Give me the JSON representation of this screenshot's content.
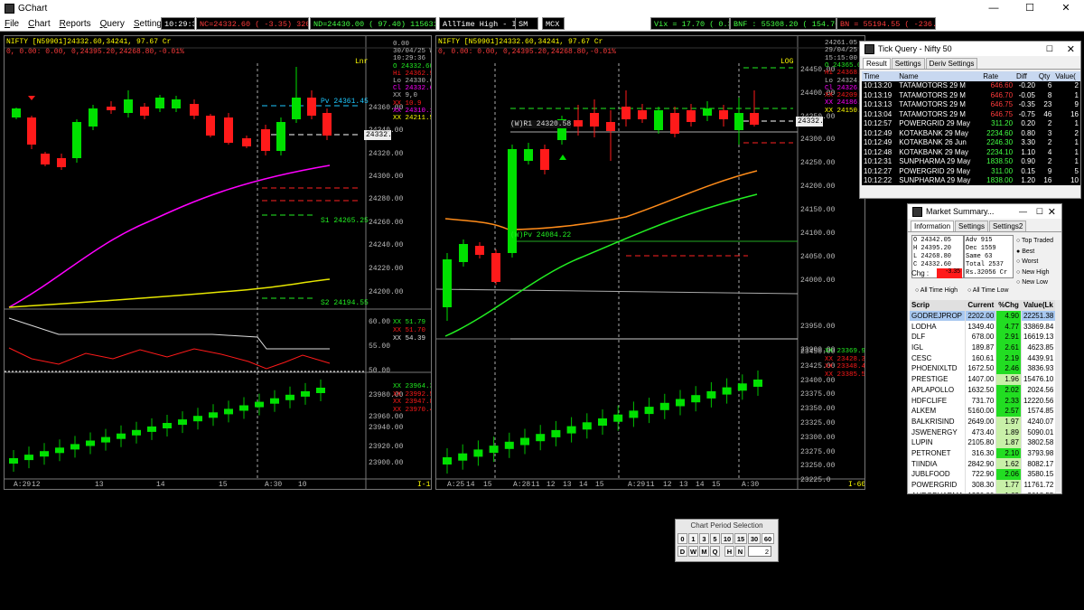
{
  "window": {
    "title": "GChart",
    "controls": [
      "—",
      "☐",
      "✕"
    ]
  },
  "menu": [
    "File",
    "Chart",
    "Reports",
    "Query",
    "Settings"
  ],
  "ticker": {
    "time": "10:29:37",
    "nc": "NC=24332.60 ( -3.35) 32056 Cr",
    "nd": "ND=24430.00 ( 97.40) 11563126 Cr",
    "ath": "AllTime High - INM",
    "sm": "SM",
    "mcx": "MCX",
    "vix": "Vix =   17.70 (  0.33)",
    "bnf": "BNF : 55308.20 ( 154.70)",
    "bn": "BN = 55194.55 ( -236.70)"
  },
  "colors": {
    "up": "#00e000",
    "down": "#ff1a1a",
    "ma_magenta": "#ff00ff",
    "ma_yellow": "#e6e600",
    "ma_orange": "#ff8c1a",
    "ma_green": "#22ee22"
  },
  "chart1": {
    "head": "NIFTY [N59901]24332.60,34241,  97.67  Cr",
    "sub": "0,   0.00:   0.00,  0,24395.20,24268.80,-0.01%",
    "info": [
      "0.00",
      "30/04/25 We",
      "10:29:36",
      "O 24332.60",
      "Hi 24362.9",
      "Lo 24330.65",
      "Cl 24332.60",
      "XX       9,0",
      "XX      10.9",
      "XX 24310.16",
      "XX 24211.50"
    ],
    "tag": "Lnr",
    "pv": "Pv 24361.45",
    "s1": "S1 24265.25",
    "s2": "S2 24194.55",
    "period": "I-15",
    "price_labels": [
      "24360.00",
      "24340.00",
      "24320.00",
      "24300.00",
      "24280.00",
      "24260.00",
      "24240.00",
      "24220.00",
      "24200.00"
    ],
    "last": "24332.6",
    "osc_labels": [
      "60.00",
      "55.00",
      "50.00"
    ],
    "osc_info": [
      "XX      51.79",
      "XX      51.70",
      "XX      54.39"
    ],
    "vol_labels": [
      "23980.00",
      "23960.00",
      "23940.00",
      "23920.00",
      "23900.00"
    ],
    "vol_info": [
      "XX 23964.30",
      "XX 23992.54",
      "XX 23947.89",
      "XX 23970.44"
    ],
    "x_labels": [
      "A:29",
      "12",
      "13",
      "14",
      "15",
      "A:30",
      "10"
    ]
  },
  "chart2": {
    "head": "NIFTY [N59901]24332.60,34241,  97.67  Cr",
    "sub": "0,   0.00:   0.00,  0,24395.20,24268.80,-0.01%",
    "info": [
      "24261.05",
      "29/04/25",
      "15:15:00",
      "O 24365.0",
      "Hi 24368.",
      "Lo 24324.4",
      "Cl 24326.3",
      "XX 24209.7",
      "XX 24186.6",
      "XX 24150.8"
    ],
    "tag": "LOG",
    "r1": "(W)R1 24320.58",
    "pv": "(W)Pv 24084.22",
    "period": "I-60",
    "price_labels": [
      "24450.00",
      "24400.00",
      "24350.00",
      "24300.00",
      "24250.00",
      "24200.00",
      "24150.00",
      "24100.00",
      "24050.00",
      "24000.00",
      "23950.00",
      "23900.00"
    ],
    "last": "24332.6",
    "vol_labels": [
      "23450.00",
      "23425.00",
      "23400.00",
      "23375.00",
      "23350.00",
      "23325.00",
      "23300.00",
      "23275.00",
      "23250.00",
      "23225.0"
    ],
    "vol_info": [
      "XX 23369.98",
      "XX 23428.35",
      "XX 23348.48",
      "XX 23385.56"
    ],
    "x_labels": [
      "A:25",
      "14",
      "15",
      "A:28",
      "11",
      "12",
      "13",
      "14",
      "15",
      "A:29",
      "11",
      "12",
      "13",
      "14",
      "15",
      "A:30"
    ]
  },
  "tick_query": {
    "title": "Tick Query - Nifty 50",
    "tabs": [
      "Result",
      "Settings",
      "Deriv Settings"
    ],
    "headers": [
      "Time",
      "Name",
      "Rate",
      "Diff",
      "Qty",
      "Value("
    ],
    "rows": [
      [
        "10:13:20",
        "TATAMOTORS 29 M",
        "646.60",
        "-0.20",
        "6",
        "2"
      ],
      [
        "10:13:19",
        "TATAMOTORS 29 M",
        "646.70",
        "-0.05",
        "8",
        "1"
      ],
      [
        "10:13:13",
        "TATAMOTORS 29 M",
        "646.75",
        "-0.35",
        "23",
        "9"
      ],
      [
        "10:13:04",
        "TATAMOTORS 29 M",
        "646.75",
        "-0.75",
        "46",
        "16"
      ],
      [
        "10:12:57",
        "POWERGRID 29 May",
        "311.20",
        "0.20",
        "2",
        "1"
      ],
      [
        "10:12:49",
        "KOTAKBANK 29 May",
        "2234.60",
        "0.80",
        "3",
        "2"
      ],
      [
        "10:12:49",
        "KOTAKBANK 26 Jun",
        "2246.30",
        "3.30",
        "2",
        "1"
      ],
      [
        "10:12:48",
        "KOTAKBANK 29 May",
        "2234.10",
        "1.10",
        "4",
        "1"
      ],
      [
        "10:12:31",
        "SUNPHARMA 29 May",
        "1838.50",
        "0.90",
        "2",
        "1"
      ],
      [
        "10:12:27",
        "POWERGRID 29 May",
        "311.00",
        "0.15",
        "9",
        "5"
      ],
      [
        "10:12:22",
        "SUNPHARMA 29 May",
        "1838.00",
        "1.20",
        "16",
        "10"
      ]
    ]
  },
  "market_summary": {
    "title": "Market Summary...",
    "tabs": [
      "Information",
      "Settings",
      "Settings2"
    ],
    "ohlc": [
      "O  24342.05",
      "H  24395.20",
      "L  24268.80",
      "C  24332.60"
    ],
    "stats": [
      "Adv    915",
      "Dec   1559",
      "Same    63",
      "Total 2537",
      "Rs.32056 Cr"
    ],
    "chg_label": "Chg :",
    "chg_value": "-3.35",
    "radios": [
      "Top Traded",
      "Best",
      "Worst",
      "New High",
      "New Low"
    ],
    "selected": "Best",
    "extremes": [
      "All Time High",
      "All Time Low"
    ],
    "headers": [
      "Scrip",
      "Current",
      "%Chg",
      "Value(Lk"
    ],
    "rows": [
      [
        "GODREJPROP",
        "2202.00",
        "4.90",
        "22251.38"
      ],
      [
        "LODHA",
        "1349.40",
        "4.77",
        "33869.84"
      ],
      [
        "DLF",
        "678.00",
        "2.91",
        "16619.13"
      ],
      [
        "IGL",
        "189.87",
        "2.61",
        "4623.85"
      ],
      [
        "CESC",
        "160.61",
        "2.19",
        "4439.91"
      ],
      [
        "PHOENIXLTD",
        "1672.50",
        "2.46",
        "3836.93"
      ],
      [
        "PRESTIGE",
        "1407.00",
        "1.96",
        "15476.10"
      ],
      [
        "APLAPOLLO",
        "1632.50",
        "2.02",
        "2024.56"
      ],
      [
        "HDFCLIFE",
        "731.70",
        "2.33",
        "12220.56"
      ],
      [
        "ALKEM",
        "5160.00",
        "2.57",
        "1574.85"
      ],
      [
        "BALKRISIND",
        "2649.00",
        "1.97",
        "4240.07"
      ],
      [
        "JSWENERGY",
        "473.40",
        "1.89",
        "5090.01"
      ],
      [
        "LUPIN",
        "2105.80",
        "1.87",
        "3802.58"
      ],
      [
        "PETRONET",
        "316.30",
        "2.10",
        "3793.98"
      ],
      [
        "TIINDIA",
        "2842.90",
        "1.62",
        "8082.17"
      ],
      [
        "JUBLFOOD",
        "722.90",
        "2.06",
        "3580.15"
      ],
      [
        "POWERGRID",
        "308.30",
        "1.77",
        "11761.72"
      ],
      [
        "AUROPHARMA",
        "1230.00",
        "1.69",
        "2618.55"
      ]
    ]
  },
  "period_dialog": {
    "title": "Chart Period Selection",
    "row1": [
      "0",
      "1",
      "3",
      "5",
      "10",
      "15",
      "30",
      "60"
    ],
    "row2": [
      "D",
      "W",
      "M",
      "Q",
      "H",
      "N"
    ],
    "value": "2"
  }
}
